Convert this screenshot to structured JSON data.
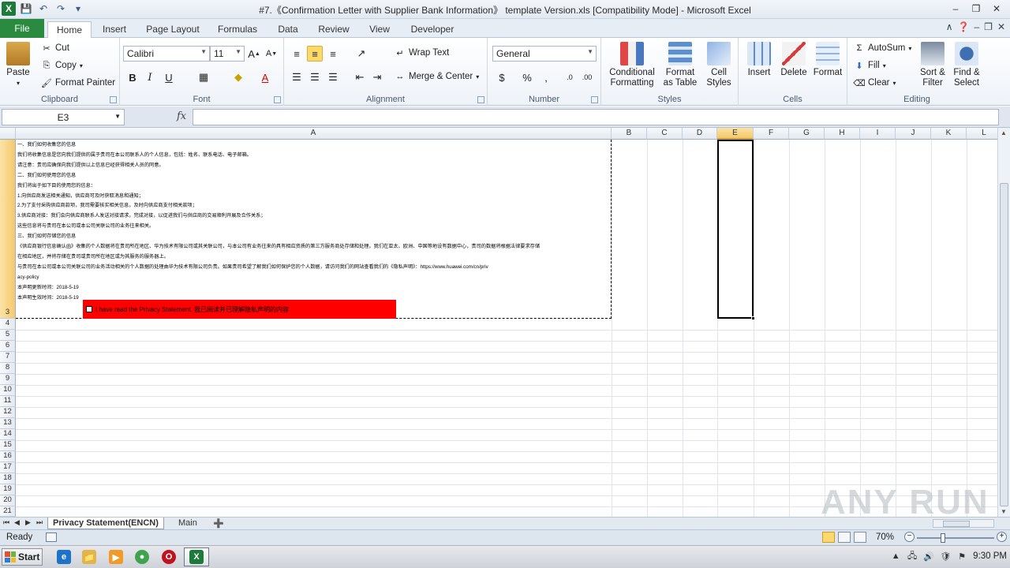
{
  "title": "#7.《Confirmation Letter with Supplier Bank Information》 template Version.xls  [Compatibility Mode]  -  Microsoft Excel",
  "tabs": [
    "File",
    "Home",
    "Insert",
    "Page Layout",
    "Formulas",
    "Data",
    "Review",
    "View",
    "Developer"
  ],
  "active_tab": "Home",
  "ribbon": {
    "clipboard": {
      "label": "Clipboard",
      "paste": "Paste",
      "cut": "Cut",
      "copy": "Copy",
      "format_painter": "Format Painter"
    },
    "font": {
      "label": "Font",
      "name": "Calibri",
      "size": "11"
    },
    "alignment": {
      "label": "Alignment",
      "wrap": "Wrap Text",
      "merge": "Merge & Center"
    },
    "number": {
      "label": "Number",
      "format": "General"
    },
    "styles": {
      "label": "Styles",
      "conditional": "Conditional",
      "conditional2": "Formatting",
      "format_table": "Format",
      "format_table2": "as Table",
      "cell_styles": "Cell",
      "cell_styles2": "Styles"
    },
    "cells": {
      "label": "Cells",
      "insert": "Insert",
      "delete": "Delete",
      "format": "Format"
    },
    "editing": {
      "label": "Editing",
      "autosum": "AutoSum",
      "fill": "Fill",
      "clear": "Clear",
      "sort": "Sort &",
      "sort2": "Filter",
      "find": "Find &",
      "find2": "Select"
    }
  },
  "name_box": "E3",
  "columns": [
    "A",
    "B",
    "C",
    "D",
    "E",
    "F",
    "G",
    "H",
    "I",
    "J",
    "K",
    "L"
  ],
  "selected_column": "E",
  "rows": [
    "3",
    "4",
    "5",
    "6",
    "7",
    "8",
    "9",
    "10",
    "11",
    "12",
    "13",
    "14",
    "15",
    "16",
    "17",
    "18",
    "19",
    "20",
    "21"
  ],
  "selected_row": "3",
  "cell_a3_lines": [
    "一、我们如何收集您的信息",
    "我们将收集信息是您向我们提供的属于贵司在本公司联系人的个人信息，包括：姓名、联系电话、电子邮箱。",
    "请注意：贵司应确保向我们提供以上信息已经获得相关人员的同意。",
    "二、我们如何使用您的信息",
    "我们将出于如下目的使用您的信息：",
    "1.向供应商发送相关通知，供应商可及时获取消息和通知；",
    "2.为了支付采购供应商款项，我司需要核实相关信息，及时向供应商支付相关款项；",
    "3.供应商对接：我们会向供应商联系人发送对接请求，完成对接，以促进我们与供应商的交易顺利开展及合作关系；",
    "这些信息将与贵司在本公司或本公司关联公司的业务往来相关。",
    "三、我们如何存储您的信息",
    "《供应商银行信息确认函》收集的个人数据将在贵司所在地区、华为技术有限公司或其关联公司，与本公司有业务往来的具有相应资质的第三方服务商处存储和处理。我们在亚太、欧洲、中国等地设有数据中心，贵司的数据将根据法律要求存储",
    "在相应地区，并将存储在贵司或贵司所在地区或为其服务的服务器上。",
    "与贵司在本公司或本公司关联公司的业务活动相关的个人数据的处理由华为技术有限公司负责。如果贵司希望了解我们如何保护您的个人数据，请访问我们的网站查看我们的《隐私声明》：https://www.huawei.com/cn/priv",
    "acy-policy",
    "本声明更新时间：2018-5-19",
    "本声明生效时间：2018-5-19"
  ],
  "consent_text": "I have read the Privacy Statement. 我已阅读并已理解隐私声明的内容",
  "sheet_tabs": [
    "Privacy Statement(ENCN)",
    "Main"
  ],
  "active_sheet": "Privacy Statement(ENCN)",
  "status": "Ready",
  "zoom": "70%",
  "zoom_level_percent": 70,
  "taskbar": {
    "start": "Start",
    "clock": "9:30 PM"
  },
  "watermark": "ANY RUN",
  "colors": {
    "selected_header": "#f5c96b",
    "consent_fill": "#ff0000",
    "file_tab": "#2a8a3f"
  }
}
